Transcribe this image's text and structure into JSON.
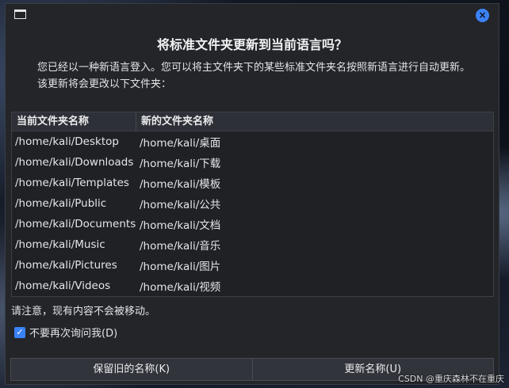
{
  "dialog": {
    "heading": "将标准文件夹更新到当前语言吗？",
    "message": "您已经以一种新语言登入。您可以将主文件夹下的某些标准文件夹名按照新语言进行自动更新。该更新将会更改以下文件夹：",
    "close_icon": "×"
  },
  "table": {
    "columns": [
      "当前文件夹名称",
      "新的文件夹名称"
    ],
    "rows": [
      [
        "/home/kali/Desktop",
        "/home/kali/桌面"
      ],
      [
        "/home/kali/Downloads",
        "/home/kali/下载"
      ],
      [
        "/home/kali/Templates",
        "/home/kali/模板"
      ],
      [
        "/home/kali/Public",
        "/home/kali/公共"
      ],
      [
        "/home/kali/Documents",
        "/home/kali/文档"
      ],
      [
        "/home/kali/Music",
        "/home/kali/音乐"
      ],
      [
        "/home/kali/Pictures",
        "/home/kali/图片"
      ],
      [
        "/home/kali/Videos",
        "/home/kali/视频"
      ]
    ]
  },
  "notice": "请注意，现有内容不会被移动。",
  "checkbox": {
    "label": "不要再次询问我(D)",
    "checked": true,
    "mark": "✓"
  },
  "buttons": {
    "keep": "保留旧的名称(K)",
    "update": "更新名称(U)"
  },
  "watermark": "CSDN @重庆森林不在重庆",
  "colors": {
    "accent": "#3b82f6",
    "dialog_bg": "#232529"
  }
}
